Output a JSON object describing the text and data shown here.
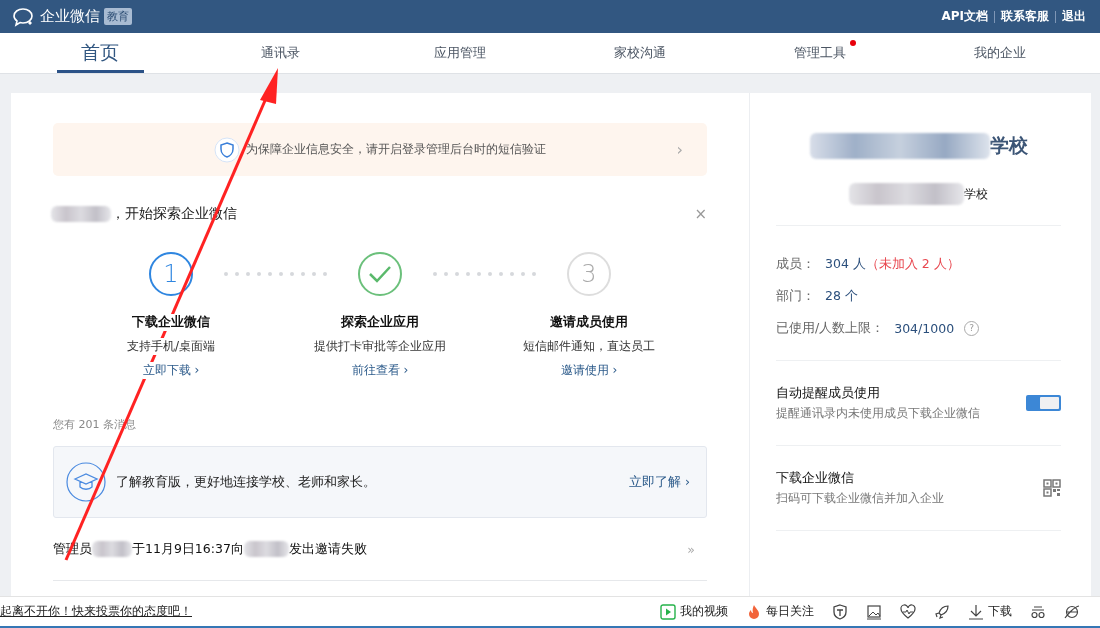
{
  "header": {
    "logo_text": "企业微信",
    "badge": "教育",
    "links": [
      "API文档",
      "联系客服",
      "退出"
    ]
  },
  "tabs": [
    {
      "label": "首页",
      "selected": true,
      "dot": false
    },
    {
      "label": "通讯录",
      "selected": false,
      "dot": false
    },
    {
      "label": "应用管理",
      "selected": false,
      "dot": false
    },
    {
      "label": "家校沟通",
      "selected": false,
      "dot": false
    },
    {
      "label": "管理工具",
      "selected": false,
      "dot": true
    },
    {
      "label": "我的企业",
      "selected": false,
      "dot": false
    }
  ],
  "security_banner": {
    "text": "为保障企业信息安全，请开启登录管理后台时的短信验证",
    "arrow": "›"
  },
  "welcome": {
    "text": "，开始探索企业微信",
    "close": "×"
  },
  "steps": [
    {
      "kind": "active",
      "mark": "1",
      "title": "下载企业微信",
      "desc": "支持手机/桌面端",
      "link": "立即下载 ›"
    },
    {
      "kind": "done",
      "title": "探索企业应用",
      "desc": "提供打卡审批等企业应用",
      "link": "前往查看 ›"
    },
    {
      "kind": "pending",
      "mark": "3",
      "title": "邀请成员使用",
      "desc": "短信邮件通知，直达员工",
      "link": "邀请使用 ›"
    }
  ],
  "message_count": "您有 201 条消息",
  "promo": {
    "text": "了解教育版，更好地连接学校、老师和家长。",
    "link": "立即了解 ›"
  },
  "messages": [
    {
      "prefix": "管理员",
      "middle": "于11月9日16:37向",
      "suffix": "发出邀请失败",
      "more": "»"
    }
  ],
  "org": {
    "name": "学校",
    "subname": "学校"
  },
  "stats": [
    {
      "label": "成员：",
      "value": "304 人",
      "extra": "（未加入 2 人）"
    },
    {
      "label": "部门：",
      "value": "28 个"
    },
    {
      "label": "已使用/人数上限：",
      "value": "304/1000",
      "help": "?"
    }
  ],
  "settings": [
    {
      "kind": "toggle",
      "title": "自动提醒成员使用",
      "desc": "提醒通讯录内未使用成员下载企业微信",
      "on": true
    },
    {
      "kind": "qr",
      "title": "下载企业微信",
      "desc": "扫码可下载企业微信并加入企业"
    }
  ],
  "browser_bar": {
    "notice": "起离不开你！快来投票你的态度吧！",
    "items": [
      {
        "kind": "video",
        "label": "我的视频"
      },
      {
        "kind": "fire",
        "label": "每日关注"
      },
      {
        "kind": "shield"
      },
      {
        "kind": "image"
      },
      {
        "kind": "heart"
      },
      {
        "kind": "rocket"
      },
      {
        "kind": "download",
        "label": "下载"
      },
      {
        "kind": "glasses"
      },
      {
        "kind": "ie"
      }
    ]
  }
}
